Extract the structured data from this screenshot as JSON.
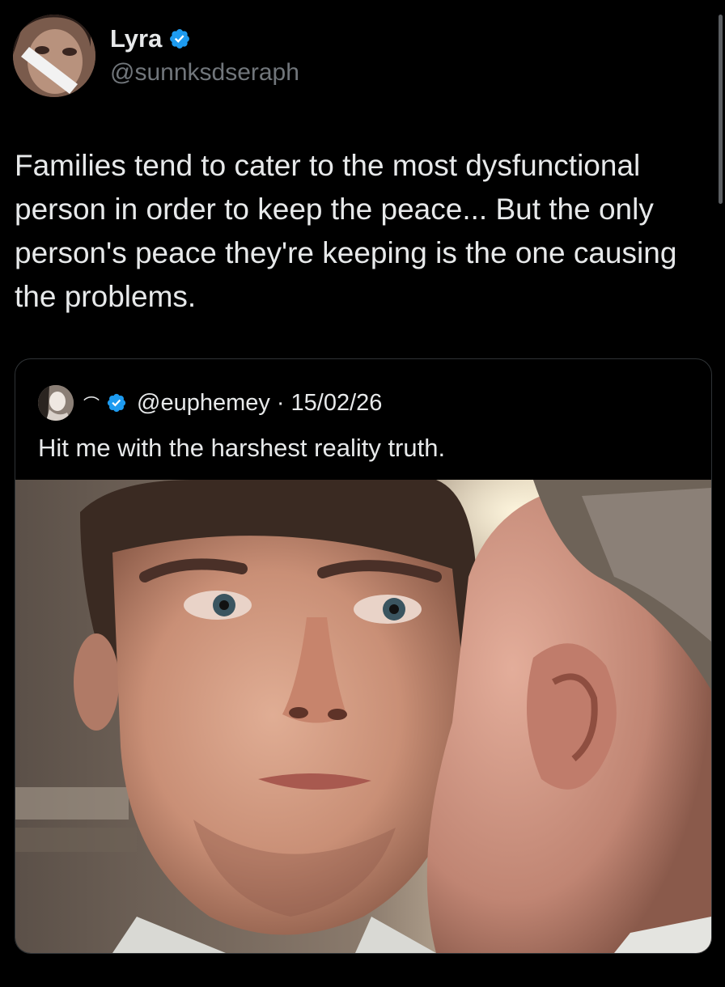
{
  "author": {
    "display_name": "Lyra",
    "handle": "@sunnksdseraph",
    "verified": true,
    "avatar_icon": "profile-photo"
  },
  "tweet": {
    "text": "Families tend to cater to the most dysfunctional person in order to keep the peace... But the only person's peace they're keeping is the one causing the problems."
  },
  "quoted_tweet": {
    "name_glyph": "⌒",
    "verified": true,
    "handle": "@euphemey",
    "separator": "·",
    "date": "15/02/26",
    "text": "Hit me with the harshest reality truth.",
    "media": "photo of a man whispering into the ear of a tearful man"
  },
  "colors": {
    "background": "#000000",
    "text_primary": "#e7e9ea",
    "text_secondary": "#71767b",
    "verified_blue": "#1d9bf0",
    "border": "#2f3336"
  }
}
